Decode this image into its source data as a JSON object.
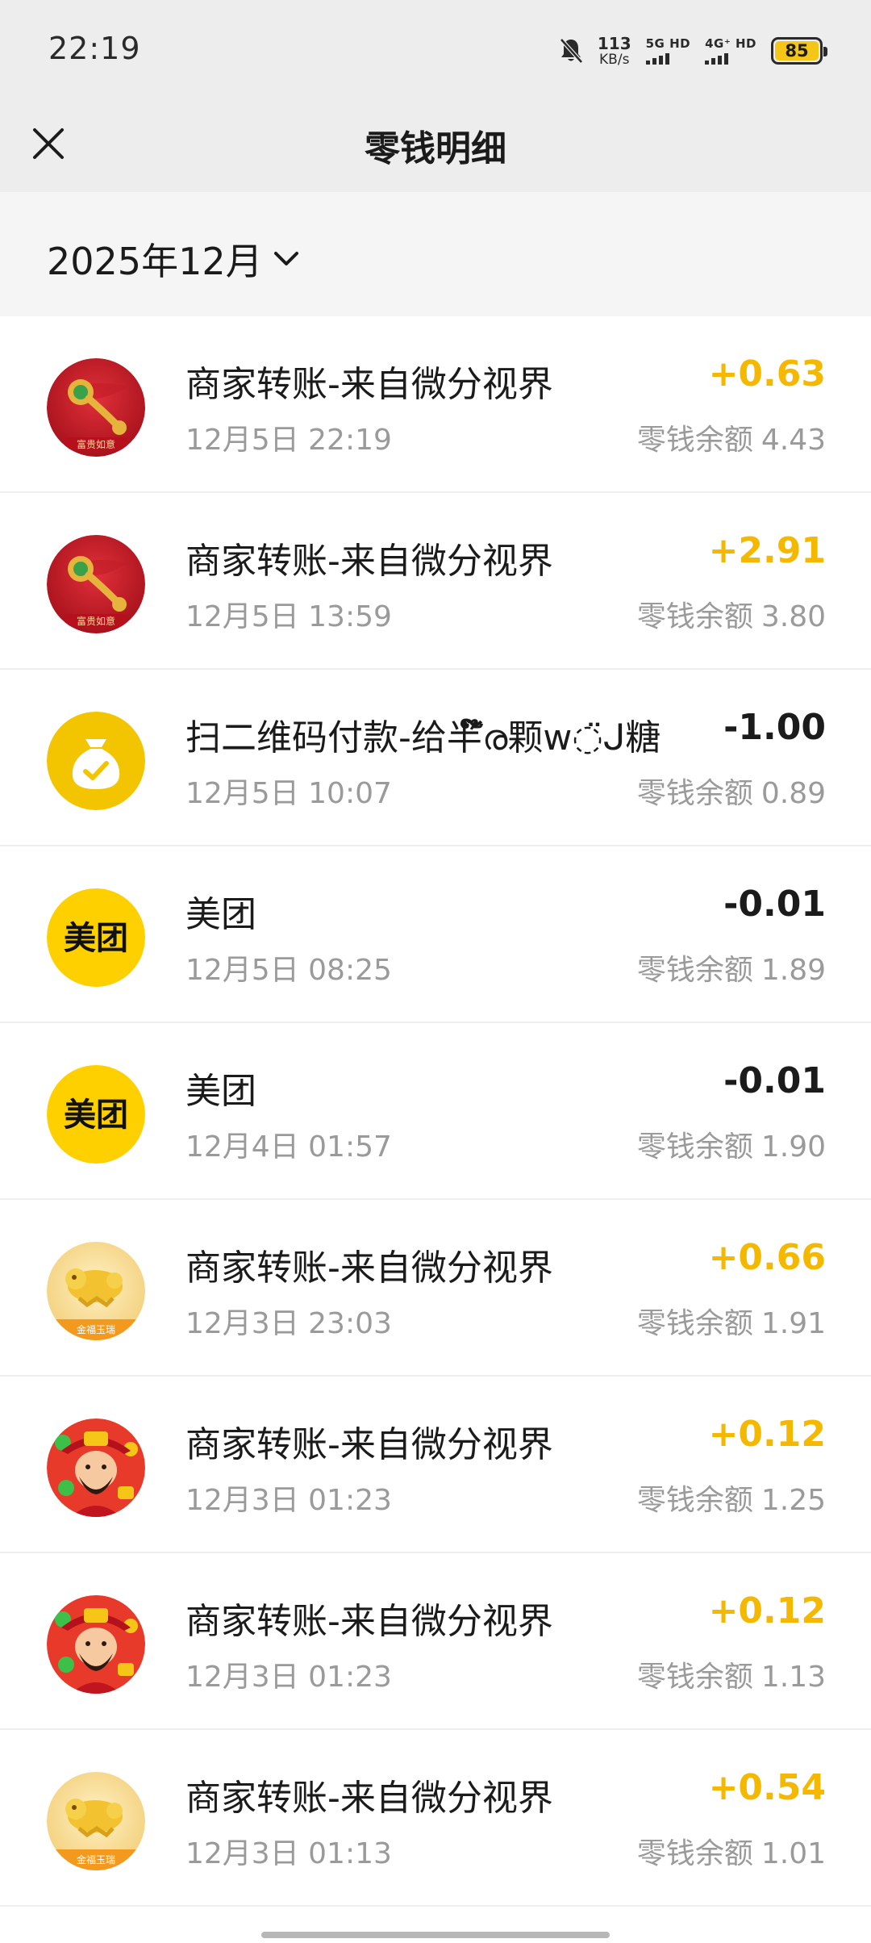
{
  "status_bar": {
    "time": "22:19",
    "net_speed_value": "113",
    "net_speed_unit": "KB/s",
    "sim1_label": "5G HD",
    "sim2_label": "4G⁺ HD",
    "battery_level": "85"
  },
  "header": {
    "title": "零钱明细"
  },
  "filter": {
    "month": "2025年12月"
  },
  "colors": {
    "income": "#f5b800",
    "expense": "#1b1b1b",
    "secondary_text": "#9a9a9a"
  },
  "transactions": [
    {
      "title": "商家转账-来自微分视界",
      "time": "12月5日 22:19",
      "amount": "+0.63",
      "balance_label": "零钱余额",
      "balance": "4.43",
      "icon": "ruyi-red-icon",
      "avatar_text": "富贵如意"
    },
    {
      "title": "商家转账-来自微分视界",
      "time": "12月5日 13:59",
      "amount": "+2.91",
      "balance_label": "零钱余额",
      "balance": "3.80",
      "icon": "ruyi-red-icon",
      "avatar_text": "富贵如意"
    },
    {
      "title": "扫二维码付款-给半໊໌ര颗ᴡ◌̈ᒍ糖",
      "time": "12月5日 10:07",
      "amount": "-1.00",
      "balance_label": "零钱余额",
      "balance": "0.89",
      "icon": "money-bag-icon"
    },
    {
      "title": "美团",
      "time": "12月5日 08:25",
      "amount": "-0.01",
      "balance_label": "零钱余额",
      "balance": "1.89",
      "icon": "meituan-icon",
      "avatar_text": "美团"
    },
    {
      "title": "美团",
      "time": "12月4日 01:57",
      "amount": "-0.01",
      "balance_label": "零钱余额",
      "balance": "1.90",
      "icon": "meituan-icon",
      "avatar_text": "美团"
    },
    {
      "title": "商家转账-来自微分视界",
      "time": "12月3日 23:03",
      "amount": "+0.66",
      "balance_label": "零钱余额",
      "balance": "1.91",
      "icon": "golden-pixiu-icon",
      "avatar_text": "金福玉瑞"
    },
    {
      "title": "商家转账-来自微分视界",
      "time": "12月3日 01:23",
      "amount": "+0.12",
      "balance_label": "零钱余额",
      "balance": "1.25",
      "icon": "fortune-god-icon"
    },
    {
      "title": "商家转账-来自微分视界",
      "time": "12月3日 01:23",
      "amount": "+0.12",
      "balance_label": "零钱余额",
      "balance": "1.13",
      "icon": "fortune-god-icon"
    },
    {
      "title": "商家转账-来自微分视界",
      "time": "12月3日 01:13",
      "amount": "+0.54",
      "balance_label": "零钱余额",
      "balance": "1.01",
      "icon": "golden-pixiu-icon",
      "avatar_text": "金福玉瑞"
    }
  ]
}
